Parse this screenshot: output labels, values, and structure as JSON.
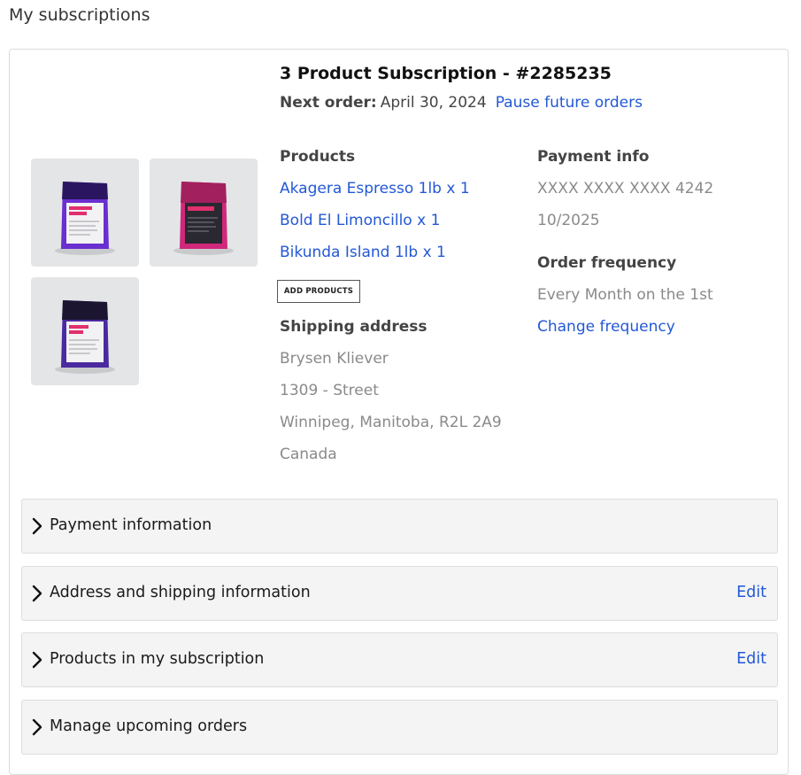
{
  "page": {
    "heading": "My subscriptions"
  },
  "subscription": {
    "title": "3 Product Subscription - #2285235",
    "next_order_label": "Next order:",
    "next_order_date": "April 30, 2024",
    "pause_link": "Pause future orders",
    "thumbnails": [
      {
        "name": "Akagera Espresso",
        "bag_color": "#6a2fd0",
        "bag_dark": "#2a1660",
        "accent": "#e0306e"
      },
      {
        "name": "Bold El Limoncillo",
        "bag_color": "#d0287a",
        "bag_dark": "#5a1236",
        "accent": "#e0306e"
      },
      {
        "name": "Bikunda Island",
        "bag_color": "#4b2aa0",
        "bag_dark": "#1c1530",
        "accent": "#e0306e"
      }
    ],
    "products": {
      "heading": "Products",
      "items": [
        "Akagera Espresso 1lb x 1",
        "Bold El Limoncillo x 1",
        "Bikunda Island 1lb x 1"
      ],
      "add_button": "ADD PRODUCTS"
    },
    "shipping": {
      "heading": "Shipping address",
      "lines": [
        "Brysen Kliever",
        "1309 - Street",
        "Winnipeg, Manitoba, R2L 2A9",
        "Canada"
      ]
    },
    "payment": {
      "heading": "Payment info",
      "card_number": "XXXX XXXX XXXX 4242",
      "expiry": "10/2025"
    },
    "frequency": {
      "heading": "Order frequency",
      "value": "Every Month on the 1st",
      "change_link": "Change frequency"
    }
  },
  "accordions": [
    {
      "label": "Payment information",
      "edit": ""
    },
    {
      "label": "Address and shipping information",
      "edit": "Edit"
    },
    {
      "label": "Products in my subscription",
      "edit": "Edit"
    },
    {
      "label": "Manage upcoming orders",
      "edit": ""
    }
  ],
  "colors": {
    "link": "#2358d6",
    "muted": "#8a8a8a",
    "accordion_bg": "#f4f4f4"
  }
}
